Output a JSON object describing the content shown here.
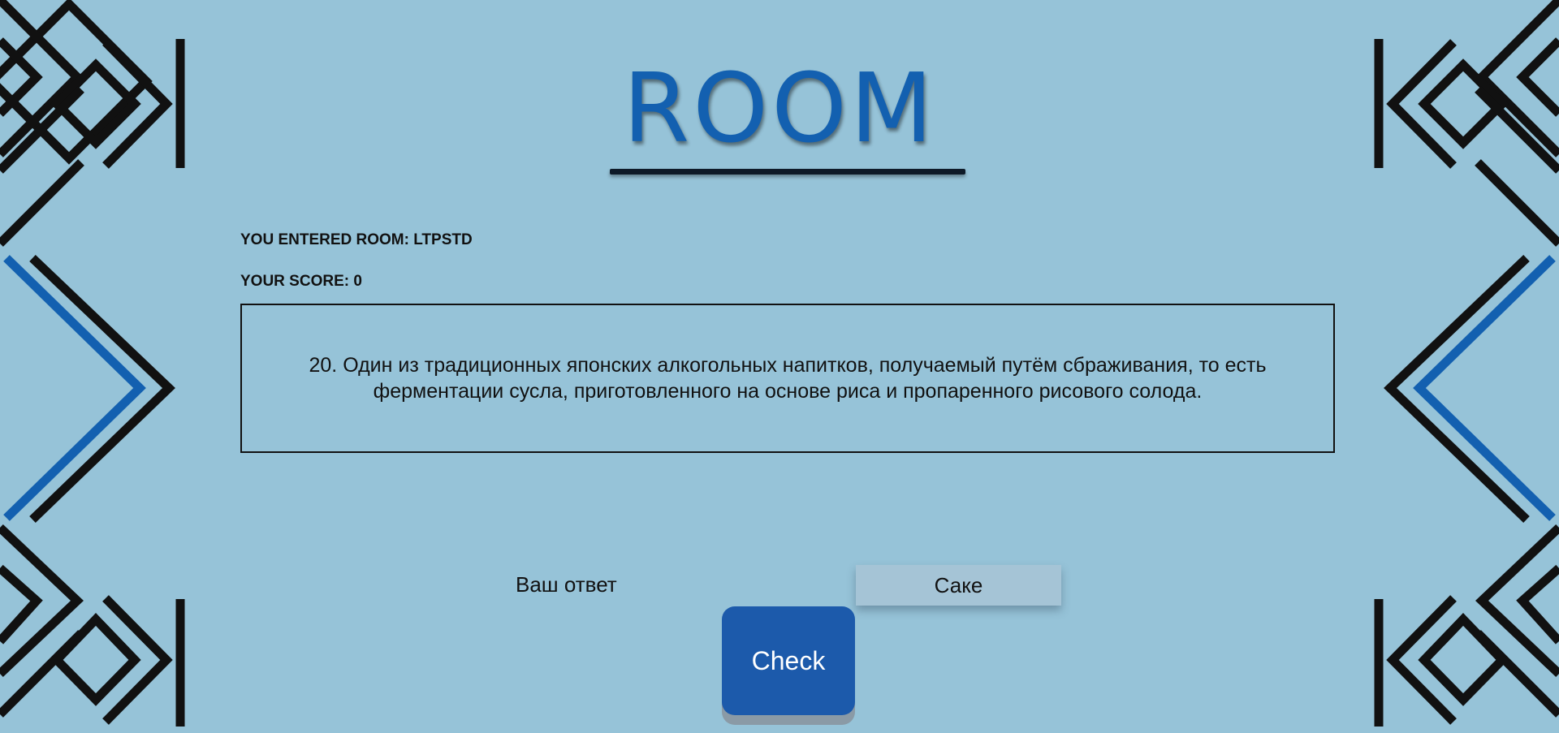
{
  "header": {
    "title": "ROOM"
  },
  "room": {
    "entered_label": "YOU ENTERED ROOM: LTPSTD",
    "score_label": "YOUR SCORE: 0"
  },
  "question": {
    "text": "20. Один из традиционных японских алкогольных напитков, получаемый путём сбраживания, то есть ферментации сусла, приготовленного на основе риса и пропаренного рисового солода."
  },
  "answer": {
    "label": "Ваш ответ",
    "value": "Саке"
  },
  "actions": {
    "check_label": "Check"
  },
  "colors": {
    "background": "#96c3d8",
    "accent_blue": "#1360b0",
    "button_blue": "#1c5aab",
    "stroke_black": "#111111"
  }
}
